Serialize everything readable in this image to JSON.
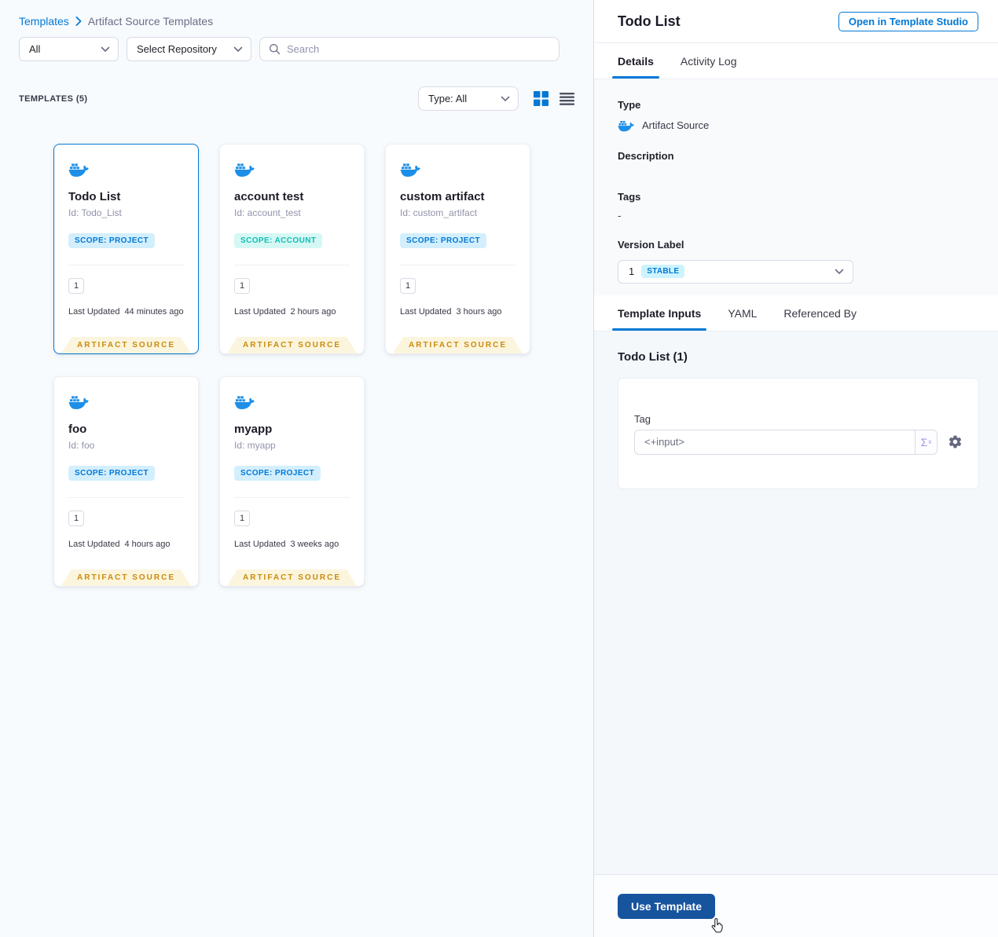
{
  "colors": {
    "accent": "#0278d5",
    "docker_blue": "#1d8fe8",
    "ribbon_bg": "#fcf5dd",
    "ribbon_text": "#ca8a0b",
    "scope_project_bg": "#d3effd",
    "scope_account_text": "#11bdb4",
    "use_button_bg": "#17549e"
  },
  "breadcrumb": {
    "templates": "Templates",
    "current": "Artifact Source Templates"
  },
  "filters": {
    "scope": "All",
    "repository": "Select Repository",
    "search_placeholder": "Search"
  },
  "list_header": {
    "count": "TEMPLATES (5)",
    "type": "Type: All"
  },
  "cards": [
    {
      "title": "Todo List",
      "id": "Id: Todo_List",
      "scope": "SCOPE: PROJECT",
      "versions": "1",
      "updated_label": "Last Updated",
      "updated": "44 minutes ago",
      "ribbon": "ARTIFACT SOURCE"
    },
    {
      "title": "account test",
      "id": "Id: account_test",
      "scope": "SCOPE: ACCOUNT",
      "versions": "1",
      "updated_label": "Last Updated",
      "updated": "2 hours ago",
      "ribbon": "ARTIFACT SOURCE"
    },
    {
      "title": "custom artifact",
      "id": "Id: custom_artifact",
      "scope": "SCOPE: PROJECT",
      "versions": "1",
      "updated_label": "Last Updated",
      "updated": "3 hours ago",
      "ribbon": "ARTIFACT SOURCE"
    },
    {
      "title": "foo",
      "id": "Id: foo",
      "scope": "SCOPE: PROJECT",
      "versions": "1",
      "updated_label": "Last Updated",
      "updated": "4 hours ago",
      "ribbon": "ARTIFACT SOURCE"
    },
    {
      "title": "myapp",
      "id": "Id: myapp",
      "scope": "SCOPE: PROJECT",
      "versions": "1",
      "updated_label": "Last Updated",
      "updated": "3 weeks ago",
      "ribbon": "ARTIFACT SOURCE"
    }
  ],
  "panel": {
    "title": "Todo List",
    "open_button": "Open in Template Studio",
    "tabs": [
      "Details",
      "Activity Log"
    ],
    "details": {
      "type_label": "Type",
      "type_value": "Artifact Source",
      "description_label": "Description",
      "tags_label": "Tags",
      "tags_value": "-",
      "version_label": "Version Label",
      "version_number": "1",
      "version_badge": "STABLE"
    },
    "inner_tabs": [
      "Template Inputs",
      "YAML",
      "Referenced By"
    ],
    "inputs": {
      "section_title": "Todo List (1)",
      "tag_label": "Tag",
      "tag_value": "<+input>",
      "expression_sigma": "Σ",
      "expression_sup": "x"
    },
    "use_button": "Use Template"
  },
  "icons": {
    "docker-whale-icon": "docker whale with containers",
    "chevron-right-icon": "›",
    "chevron-down-icon": "⌄",
    "search-icon": "magnifier",
    "grid-view-icon": "2x2 squares",
    "list-view-icon": "4 bars",
    "expression-icon": "Σx",
    "gear-icon": "⚙",
    "hand-cursor-icon": "pointer hand"
  }
}
